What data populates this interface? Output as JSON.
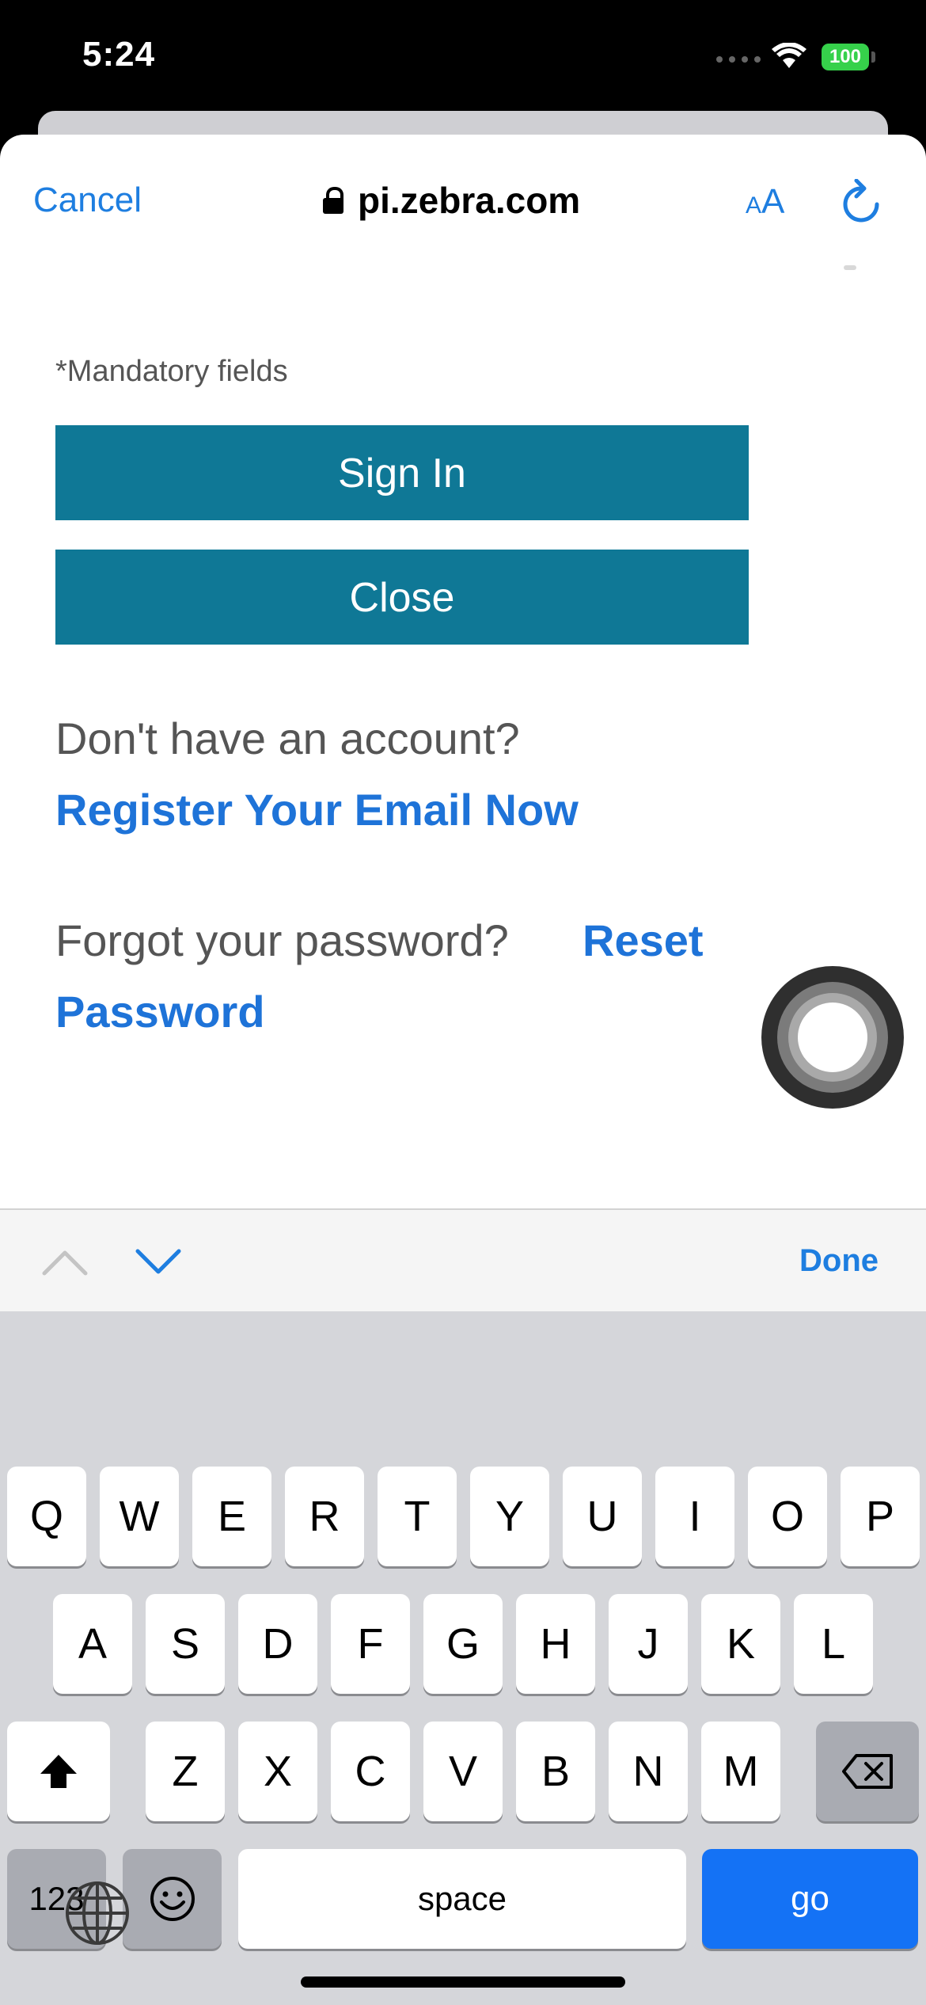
{
  "status": {
    "time": "5:24",
    "battery": "100"
  },
  "browser": {
    "cancel_label": "Cancel",
    "url": "pi.zebra.com",
    "text_size_small": "A",
    "text_size_large": "A"
  },
  "form": {
    "mandatory_note": "*Mandatory fields",
    "sign_in_label": "Sign In",
    "close_label": "Close",
    "no_account_text": "Don't have an account?",
    "register_link": "Register Your Email Now",
    "forgot_text": "Forgot your password?",
    "reset_link_line1": "Reset",
    "reset_link_line2": "Password"
  },
  "accessory": {
    "done_label": "Done"
  },
  "keyboard": {
    "row1": [
      "Q",
      "W",
      "E",
      "R",
      "T",
      "Y",
      "U",
      "I",
      "O",
      "P"
    ],
    "row2": [
      "A",
      "S",
      "D",
      "F",
      "G",
      "H",
      "J",
      "K",
      "L"
    ],
    "row3": [
      "Z",
      "X",
      "C",
      "V",
      "B",
      "N",
      "M"
    ],
    "numbers_label": "123",
    "space_label": "space",
    "go_label": "go"
  }
}
